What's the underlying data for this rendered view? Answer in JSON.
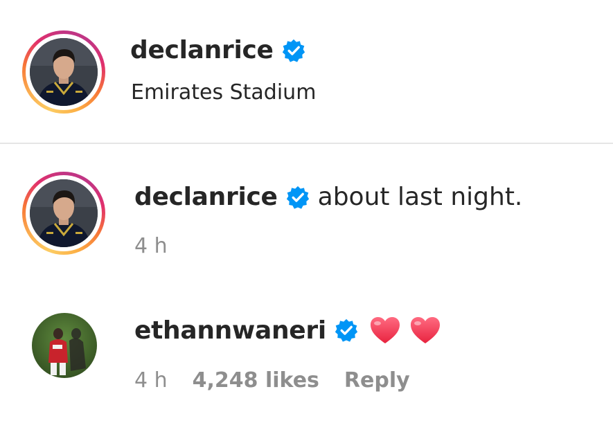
{
  "header": {
    "username": "declanrice",
    "location": "Emirates Stadium"
  },
  "comments": [
    {
      "username": "declanrice",
      "text": "about last night.",
      "time": "4 h"
    },
    {
      "username": "ethannwaneri",
      "emoji": "heart heart",
      "time": "4 h",
      "likes": "4,248 likes",
      "reply_label": "Reply"
    }
  ],
  "colors": {
    "verified_blue": "#0095f6",
    "heart_red": "#f0405a",
    "meta_gray": "#8e8e8e"
  }
}
